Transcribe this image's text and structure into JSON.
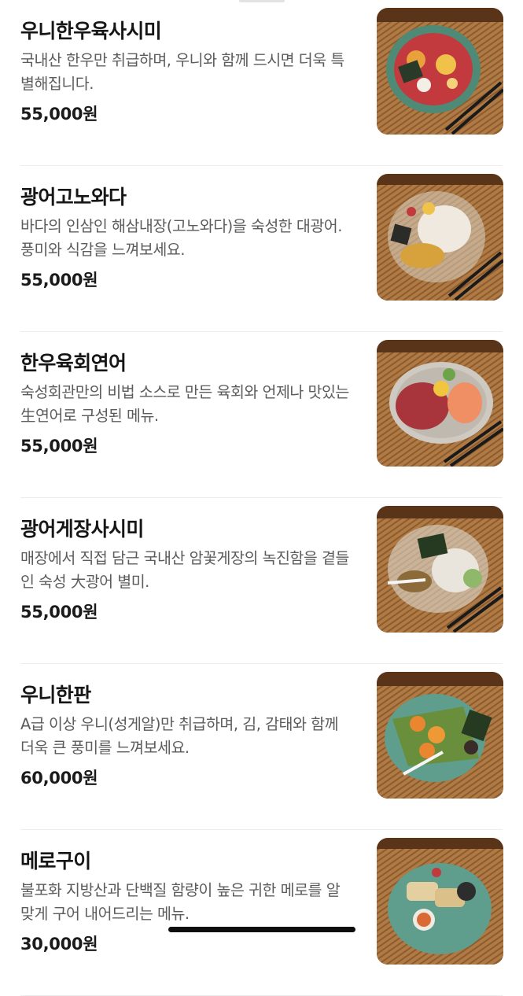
{
  "menu": {
    "items": [
      {
        "name": "우니한우육사시미",
        "description": "국내산 한우만 취급하며, 우니와 함께 드시면 더욱 특별해집니다.",
        "price": "55,000원",
        "image_alt": "우니한우육사시미"
      },
      {
        "name": "광어고노와다",
        "description": "바다의 인삼인 해삼내장(고노와다)을 숙성한 대광어. 풍미와 식감을 느껴보세요.",
        "price": "55,000원",
        "image_alt": "광어고노와다"
      },
      {
        "name": "한우육회연어",
        "description": "숙성회관만의 비법 소스로 만든 육회와 언제나 맛있는 生연어로 구성된 메뉴.",
        "price": "55,000원",
        "image_alt": "한우육회연어"
      },
      {
        "name": "광어게장사시미",
        "description": "매장에서 직접 담근 국내산 암꽃게장의 녹진함을 곁들인 숙성 大광어 별미.",
        "price": "55,000원",
        "image_alt": "광어게장사시미"
      },
      {
        "name": "우니한판",
        "description": "A급 이상 우니(성게알)만 취급하며, 김, 감태와 함께 더욱 큰 풍미를 느껴보세요.",
        "price": "60,000원",
        "image_alt": "우니한판"
      },
      {
        "name": "메로구이",
        "description": "불포화 지방산과 단백질 함량이 높은 귀한 메로를 알맞게 구어 내어드리는 메뉴.",
        "price": "30,000원",
        "image_alt": "메로구이"
      }
    ]
  },
  "colors": {
    "background": "#ffffff",
    "title": "#161616",
    "description": "#5c5c5c",
    "price": "#1b1b1b",
    "divider": "#ededed",
    "mat": "#b07a45",
    "mat_dark": "#6b4120"
  }
}
